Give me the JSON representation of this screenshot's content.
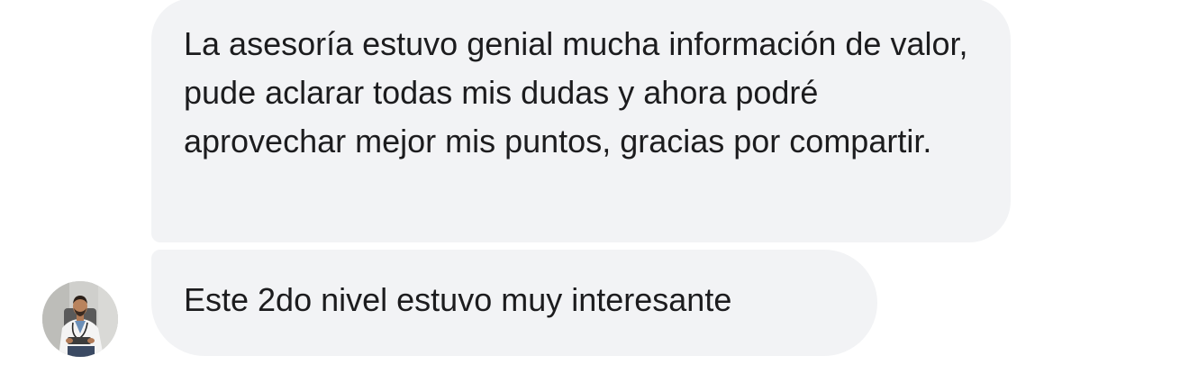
{
  "messages": [
    {
      "text": "La asesoría estuvo genial mucha información de valor, pude aclarar todas mis dudas y ahora podré aprovechar mejor mis puntos, gracias por compartir."
    },
    {
      "text": "Este 2do nivel estuvo muy interesante"
    }
  ],
  "sender": {
    "avatar_icon": "doctor-photo-avatar"
  },
  "colors": {
    "bubble_background": "#f2f3f5",
    "text": "#1c1c1e",
    "page_background": "#ffffff"
  }
}
